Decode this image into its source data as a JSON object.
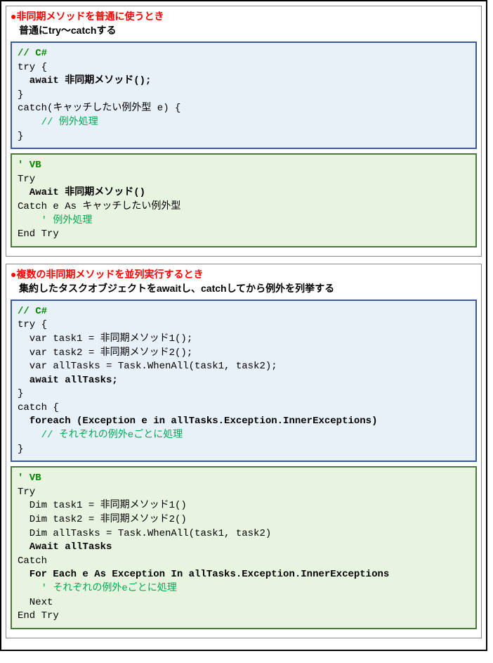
{
  "section1": {
    "title_red": "●非同期メソッドを普通に使うとき",
    "subtitle": "普通にtry～catchする",
    "cs": {
      "c0": "// C#",
      "l1": "try {",
      "l2": "  await 非同期メソッド();",
      "l3": "}",
      "l4": "catch(キャッチしたい例外型 e) {",
      "c1": "    // 例外処理",
      "l5": "}"
    },
    "vb": {
      "c0": "' VB",
      "l1": "Try",
      "l2": "  Await 非同期メソッド()",
      "l3": "Catch e As キャッチしたい例外型",
      "c1": "    ' 例外処理",
      "l4": "End Try"
    }
  },
  "section2": {
    "title_red": "●複数の非同期メソッドを並列実行するとき",
    "subtitle": "集約したタスクオブジェクトをawaitし、catchしてから例外を列挙する",
    "cs": {
      "c0": "// C#",
      "l1": "try {",
      "l2": "  var task1 = 非同期メソッド1();",
      "l3": "  var task2 = 非同期メソッド2();",
      "l4": "  var allTasks = Task.WhenAll(task1, task2);",
      "l5": "  await allTasks;",
      "l6": "}",
      "l7": "catch {",
      "l8": "  foreach (Exception e in allTasks.Exception.InnerExceptions)",
      "c1": "    // それぞれの例外eごとに処理",
      "l9": "}"
    },
    "vb": {
      "c0": "' VB",
      "l1": "Try",
      "l2": "  Dim task1 = 非同期メソッド1()",
      "l3": "  Dim task2 = 非同期メソッド2()",
      "l4": "  Dim allTasks = Task.WhenAll(task1, task2)",
      "l5": "  Await allTasks",
      "l6": "Catch",
      "l7": "  For Each e As Exception In allTasks.Exception.InnerExceptions",
      "c1": "    ' それぞれの例外eごとに処理",
      "l8": "  Next",
      "l9": "End Try"
    }
  }
}
